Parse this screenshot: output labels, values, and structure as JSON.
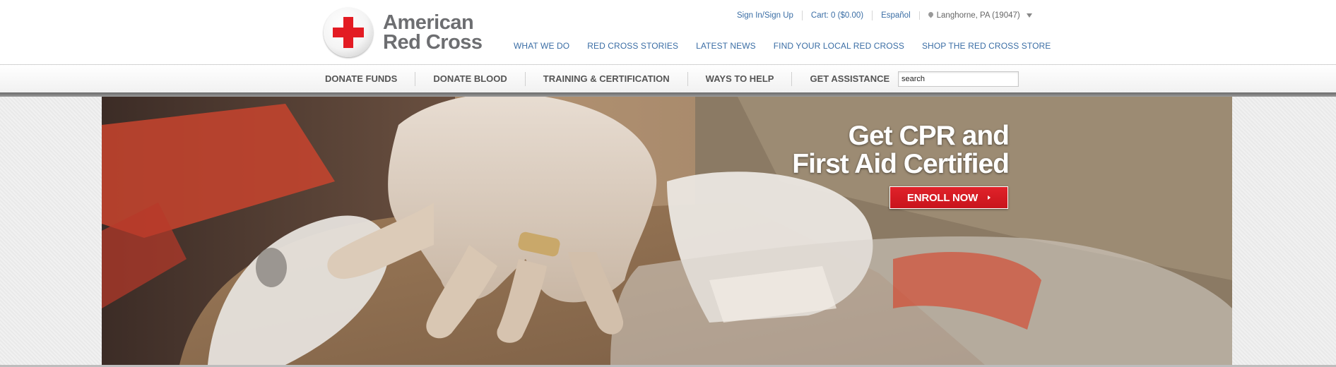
{
  "header": {
    "logo": {
      "line1": "American",
      "line2": "Red Cross"
    },
    "utility": {
      "sign_in": "Sign In/Sign Up",
      "cart": "Cart: 0 ($0.00)",
      "language": "Español",
      "location": "Langhorne, PA (19047)"
    },
    "topnav": [
      "WHAT WE DO",
      "RED CROSS STORIES",
      "LATEST NEWS",
      "FIND YOUR LOCAL RED CROSS",
      "SHOP THE RED CROSS STORE"
    ]
  },
  "mainnav": {
    "items": [
      "DONATE FUNDS",
      "DONATE BLOOD",
      "TRAINING & CERTIFICATION",
      "WAYS TO HELP",
      "GET ASSISTANCE"
    ],
    "search_value": "search"
  },
  "hero": {
    "headline_line1": "Get CPR and",
    "headline_line2": "First Aid Certified",
    "cta_label": "ENROLL NOW"
  },
  "colors": {
    "brand_red": "#e31b23",
    "link_blue": "#3b6ea5",
    "nav_text": "#555555",
    "logo_gray": "#6d6e71"
  },
  "icons": [
    "red-cross-logo-icon",
    "location-pin-icon",
    "dropdown-caret-icon",
    "arrow-right-icon"
  ]
}
